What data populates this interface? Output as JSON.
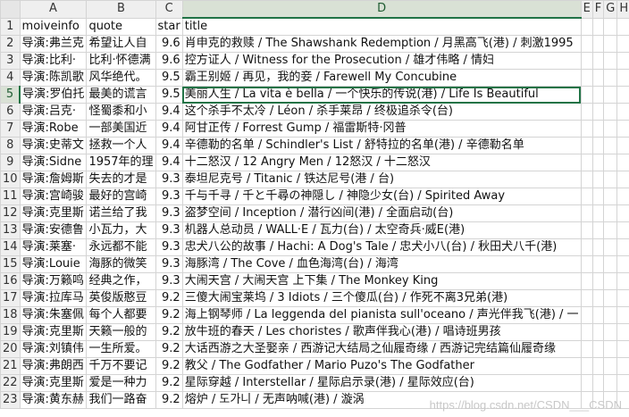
{
  "columns": [
    "A",
    "B",
    "C",
    "D",
    "E",
    "F",
    "G",
    "H",
    "I"
  ],
  "selected_column": "D",
  "selected_row": "5",
  "rows": [
    {
      "n": "1",
      "a": "moiveinfo",
      "b": "quote",
      "c": "star",
      "d": "title"
    },
    {
      "n": "2",
      "a": "导演:弗兰克",
      "b": "希望让人自",
      "c": "9.6",
      "d": "肖申克的救赎 / The Shawshank Redemption / 月黑高飞(港)  /  刺激1995"
    },
    {
      "n": "3",
      "a": "导演:比利·",
      "b": "比利·怀德满",
      "c": "9.6",
      "d": "控方证人 / Witness for the Prosecution / 雄才伟略  /  情妇"
    },
    {
      "n": "4",
      "a": "导演:陈凯歌",
      "b": "风华绝代。",
      "c": "9.5",
      "d": "霸王别姬 / 再见，我的妾  /  Farewell My Concubine"
    },
    {
      "n": "5",
      "a": "导演:罗伯托",
      "b": "最美的谎言",
      "c": "9.5",
      "d": "美丽人生 / La vita è bella / 一个快乐的传说(港)  /  Life Is Beautiful"
    },
    {
      "n": "6",
      "a": "导演:吕克·",
      "b": "怪蜀黍和小",
      "c": "9.4",
      "d": "这个杀手不太冷 / Léon / 杀手莱昂  /  终极追杀令(台)"
    },
    {
      "n": "7",
      "a": "导演:Robe",
      "b": "一部美国近",
      "c": "9.4",
      "d": "阿甘正传 / Forrest Gump / 福雷斯特·冈普"
    },
    {
      "n": "8",
      "a": "导演:史蒂文",
      "b": "拯救一个人",
      "c": "9.4",
      "d": "辛德勒的名单 / Schindler's List / 舒特拉的名单(港)  /  辛德勒名单"
    },
    {
      "n": "9",
      "a": "导演:Sidne",
      "b": "1957年的理",
      "c": "9.4",
      "d": "十二怒汉 / 12 Angry Men / 12怒汉  /  十二怒汉"
    },
    {
      "n": "10",
      "a": "导演:詹姆斯",
      "b": "失去的才是",
      "c": "9.3",
      "d": "泰坦尼克号 / Titanic / 铁达尼号(港 / 台)"
    },
    {
      "n": "11",
      "a": "导演:宫崎骏",
      "b": "最好的宫崎",
      "c": "9.3",
      "d": "千与千寻 / 千と千尋の神隠し / 神隐少女(台)  /  Spirited Away"
    },
    {
      "n": "12",
      "a": "导演:克里斯",
      "b": "诺兰给了我",
      "c": "9.3",
      "d": "盗梦空间 / Inception / 潜行凶间(港)  /  全面启动(台)"
    },
    {
      "n": "13",
      "a": "导演:安德鲁",
      "b": "小瓦力，大",
      "c": "9.3",
      "d": "机器人总动员 / WALL·E / 瓦力(台)  /  太空奇兵·威E(港)"
    },
    {
      "n": "14",
      "a": "导演:莱塞·",
      "b": "永远都不能",
      "c": "9.3",
      "d": "忠犬八公的故事 / Hachi: A Dog's Tale / 忠犬小八(台)  /  秋田犬八千(港)"
    },
    {
      "n": "15",
      "a": "导演:Louie",
      "b": "海豚的微笑",
      "c": "9.3",
      "d": "海豚湾 / The Cove / 血色海湾(台)  /  海湾"
    },
    {
      "n": "16",
      "a": "导演:万籁鸣",
      "b": "经典之作，",
      "c": "9.3",
      "d": "大闹天宫 / 大闹天宫 上下集  /  The Monkey King"
    },
    {
      "n": "17",
      "a": "导演:拉库马",
      "b": "英俊版憨豆",
      "c": "9.2",
      "d": "三傻大闹宝莱坞 / 3 Idiots / 三个傻瓜(台)  /  作死不离3兄弟(港)"
    },
    {
      "n": "18",
      "a": "导演:朱塞佩",
      "b": "每个人都要",
      "c": "9.2",
      "d": "海上钢琴师 / La leggenda del pianista sull'oceano / 声光伴我飞(港)  /  一"
    },
    {
      "n": "19",
      "a": "导演:克里斯",
      "b": "天籁一般的",
      "c": "9.2",
      "d": "放牛班的春天 / Les choristes / 歌声伴我心(港)  /  唱诗班男孩"
    },
    {
      "n": "20",
      "a": "导演:刘镇伟",
      "b": "一生所爱。",
      "c": "9.2",
      "d": "大话西游之大圣娶亲 / 西游记大结局之仙履奇缘 / 西游记完结篇仙履奇缘"
    },
    {
      "n": "21",
      "a": "导演:弗朗西",
      "b": "千万不要记",
      "c": "9.2",
      "d": "教父 / The Godfather / Mario Puzo's The Godfather"
    },
    {
      "n": "22",
      "a": "导演:克里斯",
      "b": "爱是一种力",
      "c": "9.2",
      "d": "星际穿越 / Interstellar / 星际启示录(港)  /  星际效应(台)"
    },
    {
      "n": "23",
      "a": "导演:黄东赫",
      "b": "我们一路奋",
      "c": "9.2",
      "d": "熔炉 / 도가니 / 无声呐喊(港)  /  漩涡"
    }
  ],
  "watermark": "https://blog.csdn.net/CSDN___CSDN"
}
